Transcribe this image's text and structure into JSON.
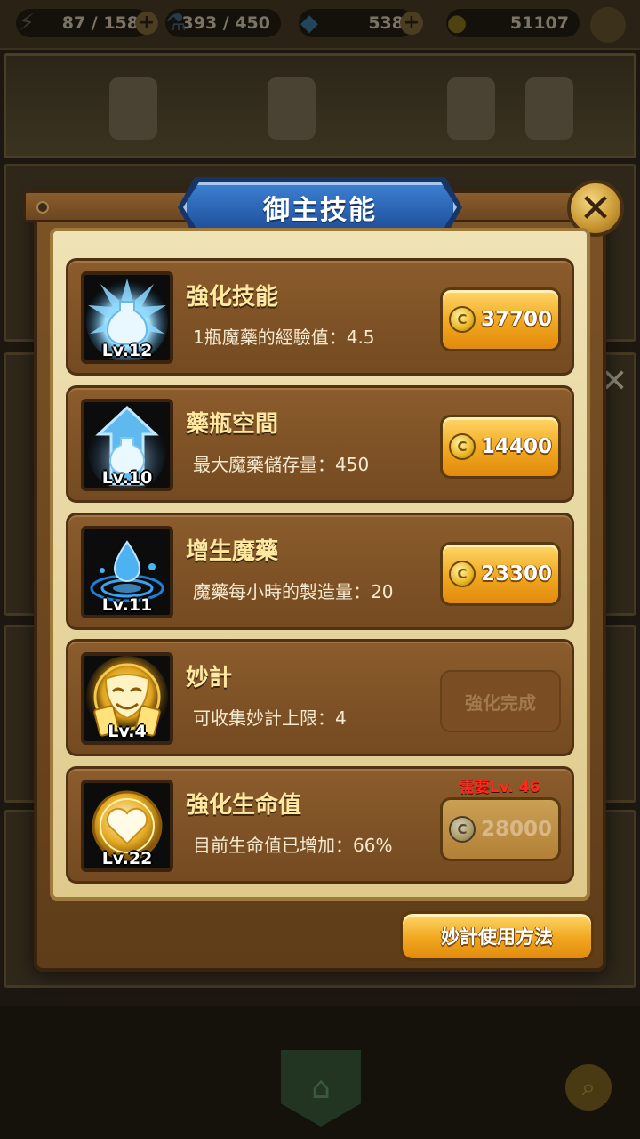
{
  "topbar": {
    "energy": "87 / 158",
    "potion": "393 / 450",
    "gems": "538",
    "coins": "51107"
  },
  "dialog": {
    "title": "御主技能",
    "close_icon": "close-x-icon",
    "help_button": "妙計使用方法"
  },
  "skills": [
    {
      "name": "強化技能",
      "desc": "1瓶魔藥的經驗值：4.5",
      "level": "Lv.12",
      "price": "37700",
      "icon": "potion-burst-icon",
      "state": "buy"
    },
    {
      "name": "藥瓶空間",
      "desc": "最大魔藥儲存量：450",
      "level": "Lv.10",
      "price": "14400",
      "icon": "potion-arrow-icon",
      "state": "buy"
    },
    {
      "name": "增生魔藥",
      "desc": "魔藥每小時的製造量：20",
      "level": "Lv.11",
      "price": "23300",
      "icon": "water-drop-icon",
      "state": "buy"
    },
    {
      "name": "妙計",
      "desc": "可收集妙計上限：4",
      "level": "Lv.4",
      "button_label": "強化完成",
      "icon": "mask-cards-icon",
      "state": "done"
    },
    {
      "name": "強化生命值",
      "desc": "目前生命值已增加：66%",
      "level": "Lv.22",
      "price": "28000",
      "requirement": "需要Lv. 46",
      "icon": "heart-icon",
      "state": "locked"
    }
  ],
  "coin_symbol": "C",
  "colors": {
    "title_banner": "#2d6bbd",
    "buy_button": "#f0a71e",
    "requirement": "#ff2a1c",
    "skill_name": "#ffe9a0"
  }
}
